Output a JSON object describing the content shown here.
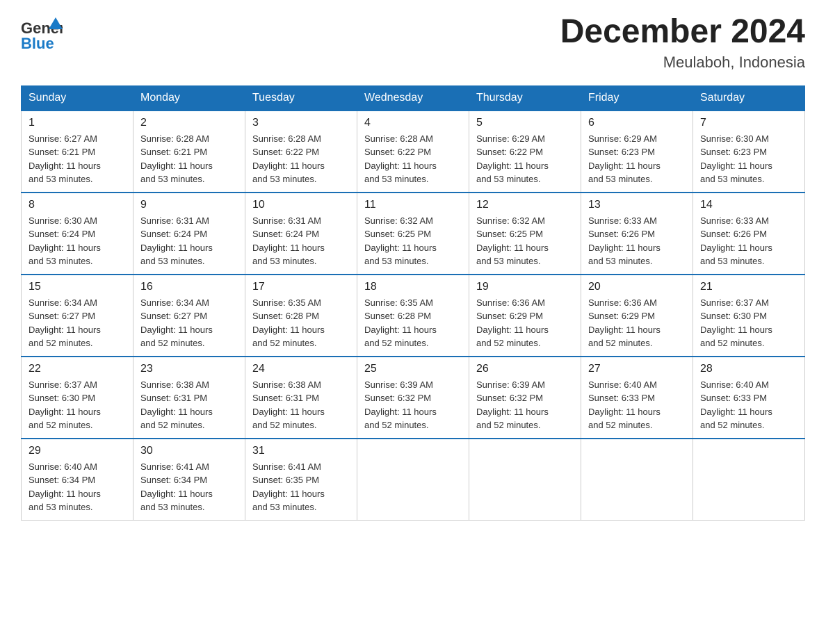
{
  "header": {
    "logo_line1": "General",
    "logo_line2": "Blue",
    "title": "December 2024",
    "subtitle": "Meulaboh, Indonesia"
  },
  "columns": [
    "Sunday",
    "Monday",
    "Tuesday",
    "Wednesday",
    "Thursday",
    "Friday",
    "Saturday"
  ],
  "weeks": [
    [
      {
        "day": "1",
        "sunrise": "6:27 AM",
        "sunset": "6:21 PM",
        "daylight": "11 hours and 53 minutes."
      },
      {
        "day": "2",
        "sunrise": "6:28 AM",
        "sunset": "6:21 PM",
        "daylight": "11 hours and 53 minutes."
      },
      {
        "day": "3",
        "sunrise": "6:28 AM",
        "sunset": "6:22 PM",
        "daylight": "11 hours and 53 minutes."
      },
      {
        "day": "4",
        "sunrise": "6:28 AM",
        "sunset": "6:22 PM",
        "daylight": "11 hours and 53 minutes."
      },
      {
        "day": "5",
        "sunrise": "6:29 AM",
        "sunset": "6:22 PM",
        "daylight": "11 hours and 53 minutes."
      },
      {
        "day": "6",
        "sunrise": "6:29 AM",
        "sunset": "6:23 PM",
        "daylight": "11 hours and 53 minutes."
      },
      {
        "day": "7",
        "sunrise": "6:30 AM",
        "sunset": "6:23 PM",
        "daylight": "11 hours and 53 minutes."
      }
    ],
    [
      {
        "day": "8",
        "sunrise": "6:30 AM",
        "sunset": "6:24 PM",
        "daylight": "11 hours and 53 minutes."
      },
      {
        "day": "9",
        "sunrise": "6:31 AM",
        "sunset": "6:24 PM",
        "daylight": "11 hours and 53 minutes."
      },
      {
        "day": "10",
        "sunrise": "6:31 AM",
        "sunset": "6:24 PM",
        "daylight": "11 hours and 53 minutes."
      },
      {
        "day": "11",
        "sunrise": "6:32 AM",
        "sunset": "6:25 PM",
        "daylight": "11 hours and 53 minutes."
      },
      {
        "day": "12",
        "sunrise": "6:32 AM",
        "sunset": "6:25 PM",
        "daylight": "11 hours and 53 minutes."
      },
      {
        "day": "13",
        "sunrise": "6:33 AM",
        "sunset": "6:26 PM",
        "daylight": "11 hours and 53 minutes."
      },
      {
        "day": "14",
        "sunrise": "6:33 AM",
        "sunset": "6:26 PM",
        "daylight": "11 hours and 53 minutes."
      }
    ],
    [
      {
        "day": "15",
        "sunrise": "6:34 AM",
        "sunset": "6:27 PM",
        "daylight": "11 hours and 52 minutes."
      },
      {
        "day": "16",
        "sunrise": "6:34 AM",
        "sunset": "6:27 PM",
        "daylight": "11 hours and 52 minutes."
      },
      {
        "day": "17",
        "sunrise": "6:35 AM",
        "sunset": "6:28 PM",
        "daylight": "11 hours and 52 minutes."
      },
      {
        "day": "18",
        "sunrise": "6:35 AM",
        "sunset": "6:28 PM",
        "daylight": "11 hours and 52 minutes."
      },
      {
        "day": "19",
        "sunrise": "6:36 AM",
        "sunset": "6:29 PM",
        "daylight": "11 hours and 52 minutes."
      },
      {
        "day": "20",
        "sunrise": "6:36 AM",
        "sunset": "6:29 PM",
        "daylight": "11 hours and 52 minutes."
      },
      {
        "day": "21",
        "sunrise": "6:37 AM",
        "sunset": "6:30 PM",
        "daylight": "11 hours and 52 minutes."
      }
    ],
    [
      {
        "day": "22",
        "sunrise": "6:37 AM",
        "sunset": "6:30 PM",
        "daylight": "11 hours and 52 minutes."
      },
      {
        "day": "23",
        "sunrise": "6:38 AM",
        "sunset": "6:31 PM",
        "daylight": "11 hours and 52 minutes."
      },
      {
        "day": "24",
        "sunrise": "6:38 AM",
        "sunset": "6:31 PM",
        "daylight": "11 hours and 52 minutes."
      },
      {
        "day": "25",
        "sunrise": "6:39 AM",
        "sunset": "6:32 PM",
        "daylight": "11 hours and 52 minutes."
      },
      {
        "day": "26",
        "sunrise": "6:39 AM",
        "sunset": "6:32 PM",
        "daylight": "11 hours and 52 minutes."
      },
      {
        "day": "27",
        "sunrise": "6:40 AM",
        "sunset": "6:33 PM",
        "daylight": "11 hours and 52 minutes."
      },
      {
        "day": "28",
        "sunrise": "6:40 AM",
        "sunset": "6:33 PM",
        "daylight": "11 hours and 52 minutes."
      }
    ],
    [
      {
        "day": "29",
        "sunrise": "6:40 AM",
        "sunset": "6:34 PM",
        "daylight": "11 hours and 53 minutes."
      },
      {
        "day": "30",
        "sunrise": "6:41 AM",
        "sunset": "6:34 PM",
        "daylight": "11 hours and 53 minutes."
      },
      {
        "day": "31",
        "sunrise": "6:41 AM",
        "sunset": "6:35 PM",
        "daylight": "11 hours and 53 minutes."
      },
      null,
      null,
      null,
      null
    ]
  ],
  "labels": {
    "sunrise": "Sunrise:",
    "sunset": "Sunset:",
    "daylight": "Daylight:"
  }
}
